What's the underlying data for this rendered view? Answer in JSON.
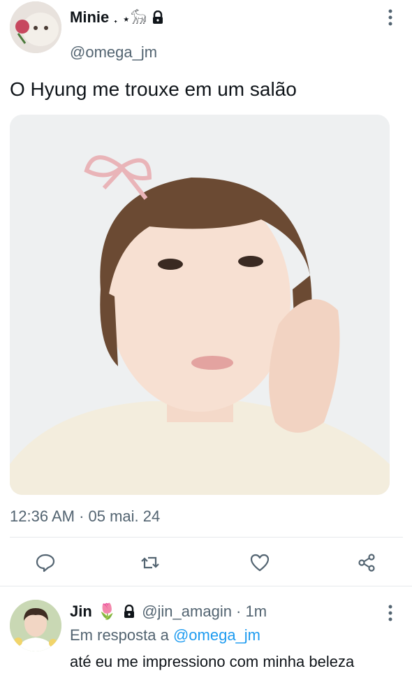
{
  "tweet": {
    "display_name": "Minie",
    "name_decoration": "˖ ⋆𓃘",
    "handle": "@omega_jm",
    "text": "O Hyung me trouxe em um salão",
    "timestamp": "12:36 AM · 05 mai. 24",
    "actions": [
      "reply-icon",
      "retweet-icon",
      "like-icon",
      "share-icon"
    ]
  },
  "reply": {
    "display_name": "Jin",
    "emoji": "🌷",
    "handle": "@jin_amagin · 1m",
    "reply_prefix": "Em resposta a ",
    "reply_to": "@omega_jm",
    "text": "até eu me impressiono com minha beleza"
  },
  "colors": {
    "text": "#0f1419",
    "secondary": "#536471",
    "link": "#1d9bf0",
    "divider": "#e6e9ec"
  }
}
